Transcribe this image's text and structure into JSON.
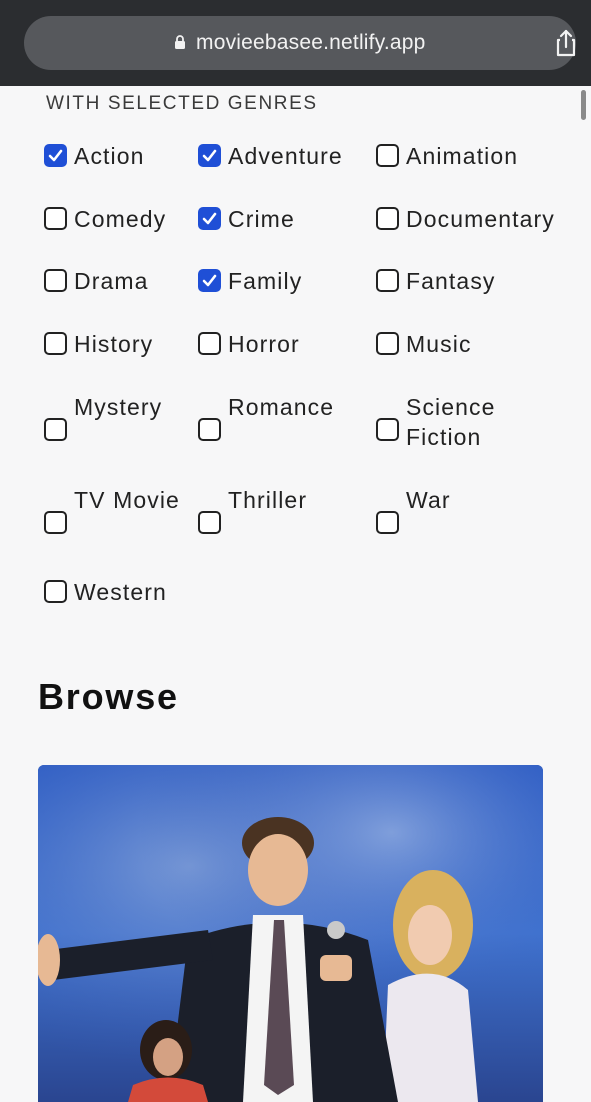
{
  "browser": {
    "url": "movieebasee.netlify.app",
    "lock_icon": "lock-icon",
    "share_icon": "share-icon"
  },
  "genres": {
    "heading": "WITH SELECTED GENRES",
    "items": [
      {
        "label": "Action",
        "checked": true
      },
      {
        "label": "Adventure",
        "checked": true
      },
      {
        "label": "Animation",
        "checked": false
      },
      {
        "label": "Comedy",
        "checked": false
      },
      {
        "label": "Crime",
        "checked": true
      },
      {
        "label": "Documentary",
        "checked": false
      },
      {
        "label": "Drama",
        "checked": false
      },
      {
        "label": "Family",
        "checked": true
      },
      {
        "label": "Fantasy",
        "checked": false
      },
      {
        "label": "History",
        "checked": false
      },
      {
        "label": "Horror",
        "checked": false
      },
      {
        "label": "Music",
        "checked": false
      },
      {
        "label": "Mystery",
        "checked": false
      },
      {
        "label": "Romance",
        "checked": false
      },
      {
        "label": "Science Fiction",
        "checked": false
      },
      {
        "label": "TV Movie",
        "checked": false
      },
      {
        "label": "Thriller",
        "checked": false
      },
      {
        "label": "War",
        "checked": false
      },
      {
        "label": "Western",
        "checked": false
      }
    ]
  },
  "browse": {
    "title": "Browse"
  },
  "colors": {
    "accent": "#1f4fd6",
    "background": "#f7f7f8",
    "chrome": "#2b2d30"
  }
}
